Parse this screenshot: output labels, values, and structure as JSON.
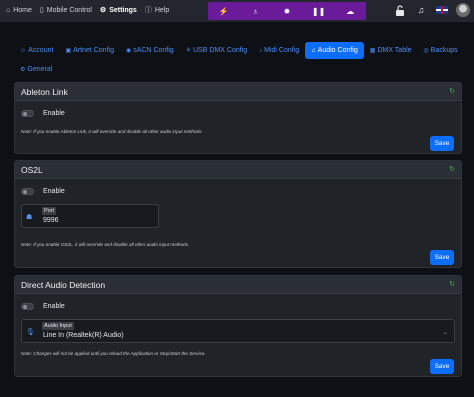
{
  "nav": {
    "home": "Home",
    "mobile_control": "Mobile Control",
    "settings": "Settings",
    "help": "Help"
  },
  "effects_bar": {
    "color": "#6a1b9a",
    "icons": [
      "bolt-icon",
      "bulb-icon",
      "sun-icon",
      "pause-icon",
      "cloud-icon"
    ]
  },
  "toolbar_icons": [
    "lock-open-icon",
    "music-icon",
    "uk-flag-icon",
    "avatar"
  ],
  "tabs": [
    {
      "label": "Account",
      "icon": "user-icon",
      "glyph": "☺"
    },
    {
      "label": "Artnet Config",
      "icon": "film-icon",
      "glyph": "▣"
    },
    {
      "label": "sACN Config",
      "icon": "broadcast-icon",
      "glyph": "◉"
    },
    {
      "label": "USB DMX Config",
      "icon": "usb-icon",
      "glyph": "⚘"
    },
    {
      "label": "Midi Config",
      "icon": "midi-icon",
      "glyph": "♪"
    },
    {
      "label": "Audio Config",
      "icon": "audio-icon",
      "glyph": "♫",
      "active": true
    },
    {
      "label": "DMX Table",
      "icon": "table-icon",
      "glyph": "▦"
    },
    {
      "label": "Backups",
      "icon": "eye-icon",
      "glyph": "◎"
    },
    {
      "label": "General",
      "icon": "gear-icon",
      "glyph": "⚙"
    }
  ],
  "ableton": {
    "title": "Ableton Link",
    "enable_label": "Enable",
    "note": "Note: If you enable Ableton Link, it will override and disable all other audio input methods.",
    "save_label": "Save"
  },
  "os2l": {
    "title": "OS2L",
    "enable_label": "Enable",
    "port_label": "Port",
    "port_value": "9996",
    "note": "Note: If you enable OS2L, it will override and disable all other audio input methods.",
    "save_label": "Save"
  },
  "direct_audio": {
    "title": "Direct Audio Detection",
    "enable_label": "Enable",
    "input_label": "Audio Input",
    "input_value": "Line In (Realtek(R) Audio)",
    "note": "Note: Changes will not be applied until you reload the Application or Stop/Start the Service.",
    "save_label": "Save"
  },
  "colors": {
    "accent": "#0d6efd",
    "link": "#4e8ef7",
    "refresh": "#4caf50",
    "card": "#202428"
  }
}
